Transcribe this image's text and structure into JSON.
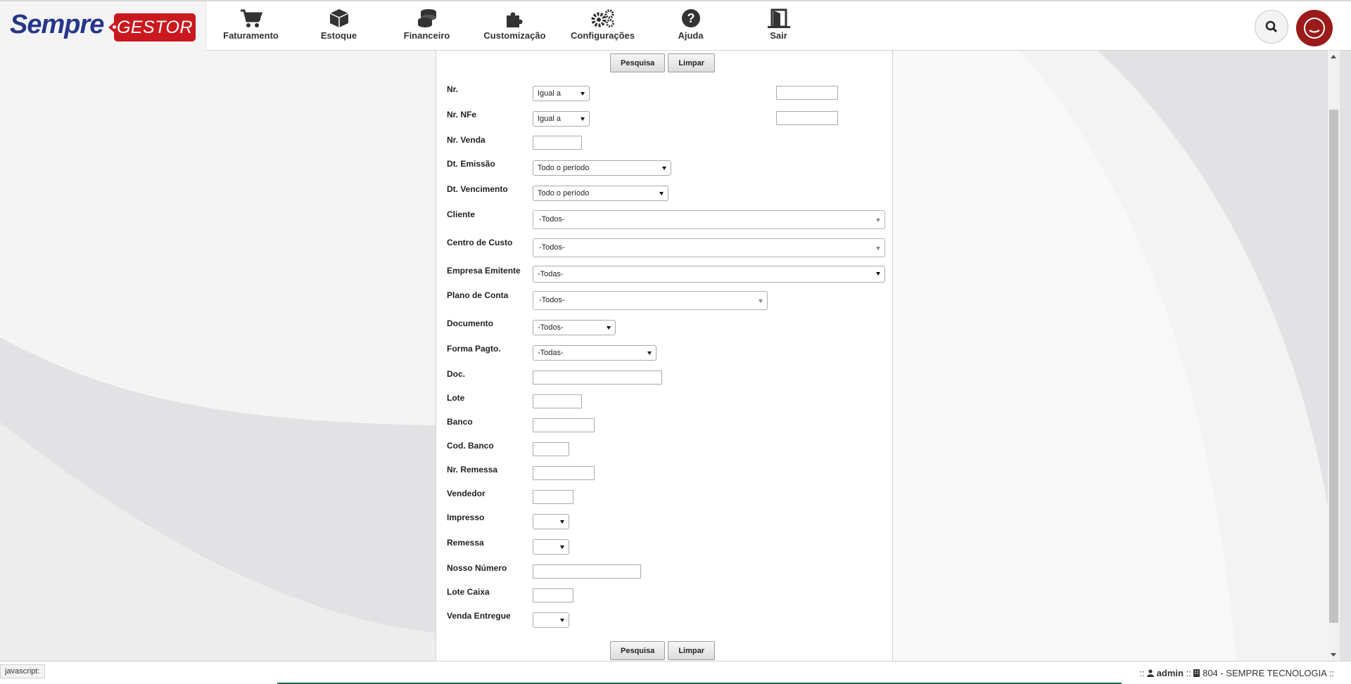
{
  "brand": {
    "name_left": "Sempre",
    "name_right": "GESTOR"
  },
  "nav": [
    {
      "label": "Faturamento",
      "icon": "cart-icon"
    },
    {
      "label": "Estoque",
      "icon": "box-icon"
    },
    {
      "label": "Financeiro",
      "icon": "coins-icon"
    },
    {
      "label": "Customização",
      "icon": "puzzle-icon"
    },
    {
      "label": "Configurações",
      "icon": "gears-icon"
    },
    {
      "label": "Ajuda",
      "icon": "help-icon"
    },
    {
      "label": "Sair",
      "icon": "exit-door-icon"
    }
  ],
  "actions": {
    "search": "Pesquisa",
    "clear": "Limpar"
  },
  "form": {
    "nr": {
      "label": "Nr.",
      "op": "Igual a"
    },
    "nrnfe": {
      "label": "Nr. NFe",
      "op": "Igual a"
    },
    "nrvenda": {
      "label": "Nr. Venda"
    },
    "dtemissao": {
      "label": "Dt. Emissão",
      "value": "Todo o período"
    },
    "dtvencimento": {
      "label": "Dt. Vencimento",
      "value": "Todo o período"
    },
    "cliente": {
      "label": "Cliente",
      "value": "-Todos-"
    },
    "centrocusto": {
      "label": "Centro de Custo",
      "value": "-Todos-"
    },
    "empresa": {
      "label": "Empresa Emitente",
      "value": "-Todas-"
    },
    "planoconta": {
      "label": "Plano de Conta",
      "value": "-Todos-"
    },
    "documento": {
      "label": "Documento",
      "value": "-Todos-"
    },
    "formapagto": {
      "label": "Forma Pagto.",
      "value": "-Todas-"
    },
    "doc": {
      "label": "Doc."
    },
    "lote": {
      "label": "Lote"
    },
    "banco": {
      "label": "Banco"
    },
    "codbanco": {
      "label": "Cod. Banco"
    },
    "nrremessa": {
      "label": "Nr. Remessa"
    },
    "vendedor": {
      "label": "Vendedor"
    },
    "impresso": {
      "label": "Impresso"
    },
    "remessa": {
      "label": "Remessa"
    },
    "nossonumero": {
      "label": "Nosso Número"
    },
    "lotecaixa": {
      "label": "Lote Caixa"
    },
    "vendaentregue": {
      "label": "Venda Entregue"
    }
  },
  "status": {
    "js": "javascript:",
    "prefix": "::",
    "user": "admin",
    "sep": "::",
    "company": "804 - SEMPRE TECNOLOGIA",
    "suffix": "::"
  }
}
